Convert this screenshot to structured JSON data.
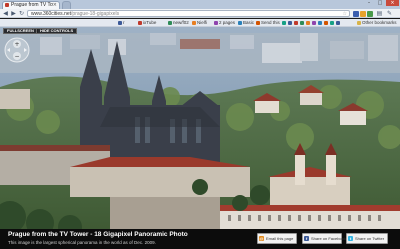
{
  "browser": {
    "tab_title": "Prague from TV Tower - World...",
    "tab_close": "×",
    "new_tab": "",
    "window_controls": {
      "minimize": "–",
      "maximize": "□",
      "close": "×"
    },
    "nav": {
      "back": "◀",
      "forward": "▶",
      "reload": "↻"
    },
    "url_host": "www.360cities.net",
    "url_path": "/prague-18-gigapixels",
    "star": "☆",
    "page_menu": "▤",
    "wrench_menu": "✎"
  },
  "bookmarks": {
    "items": [
      {
        "label": "r"
      },
      {
        "label": "ixTube"
      },
      {
        "label": "new/f02"
      },
      {
        "label": "Nielfi"
      },
      {
        "label": "2 pages"
      },
      {
        "label": "Basic"
      },
      {
        "label": "Send this"
      },
      {
        "label": "Other bookmarks"
      }
    ],
    "colors": [
      "#3b5998",
      "#c0392b",
      "#2e8b57",
      "#e67e22",
      "#8e44ad",
      "#2980b9",
      "#d35400",
      "#16a085"
    ]
  },
  "viewer": {
    "fullscreen_label": "FULLSCREEN",
    "hide_controls_label": "HIDE CONTROLS",
    "zoom_in": "+",
    "zoom_out": "−"
  },
  "caption": {
    "title": "Prague from the TV Tower - 18 Gigapixel Panoramic Photo",
    "subtitle": "This image is the largest spherical panorama in the world as of Dec. 2009."
  },
  "share": {
    "email_label": "Email this page",
    "facebook_label": "Share on Facebook",
    "twitter_label": "Share on Twitter"
  },
  "colors": {
    "caption_bg": "#0c0c0c",
    "sky": "#7f98b0",
    "cathedral": "#3a3f4a",
    "roof_red": "#9a3a2c",
    "foliage": "#4f6b3a"
  }
}
